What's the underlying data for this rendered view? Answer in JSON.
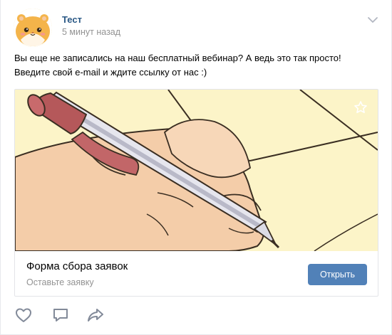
{
  "post": {
    "author_name": "Тест",
    "time": "5 минут назад",
    "text_line1": "Вы еще не записались на наш бесплатный вебинар? А ведь это так просто!",
    "text_line2": "Введите свой e-mail и ждите ссылку от нас :)"
  },
  "card": {
    "title": "Форма сбора заявок",
    "subtitle": "Оставьте заявку",
    "button_label": "Открыть"
  },
  "icons": {
    "menu": "chevron-down-icon",
    "favorite": "star-icon",
    "like": "heart-icon",
    "comment": "comment-icon",
    "share": "share-icon"
  },
  "colors": {
    "link": "#2a5885",
    "button": "#5181b8",
    "muted": "#939393"
  }
}
